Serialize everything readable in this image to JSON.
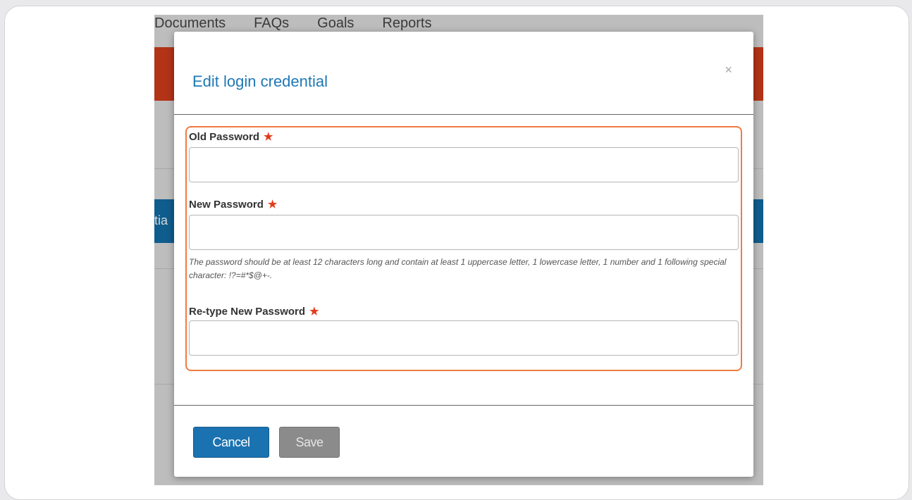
{
  "background_app": {
    "nav": [
      "Documents",
      "FAQs",
      "Goals",
      "Reports"
    ],
    "partial_tab_text": "tia"
  },
  "modal": {
    "title": "Edit login credential",
    "close_glyph": "×",
    "fields": {
      "old_password": {
        "label": "Old Password",
        "value": "",
        "required_mark": "★"
      },
      "new_password": {
        "label": "New Password",
        "value": "",
        "required_mark": "★"
      },
      "retype_password": {
        "label": "Re-type New Password",
        "value": "",
        "required_mark": "★"
      }
    },
    "help_text": "The password should be at least 12 characters long and contain at least 1 uppercase letter, 1 lowercase letter, 1 number and 1 following special character: !?=#*$@+-.",
    "buttons": {
      "cancel": "Cancel",
      "save": "Save"
    }
  },
  "colors": {
    "accent_blue": "#1a72b0",
    "title_blue": "#1f78b4",
    "highlight_orange": "#f07b3f",
    "required_red": "#e33b1c",
    "disabled_gray": "#8b8b8b"
  }
}
